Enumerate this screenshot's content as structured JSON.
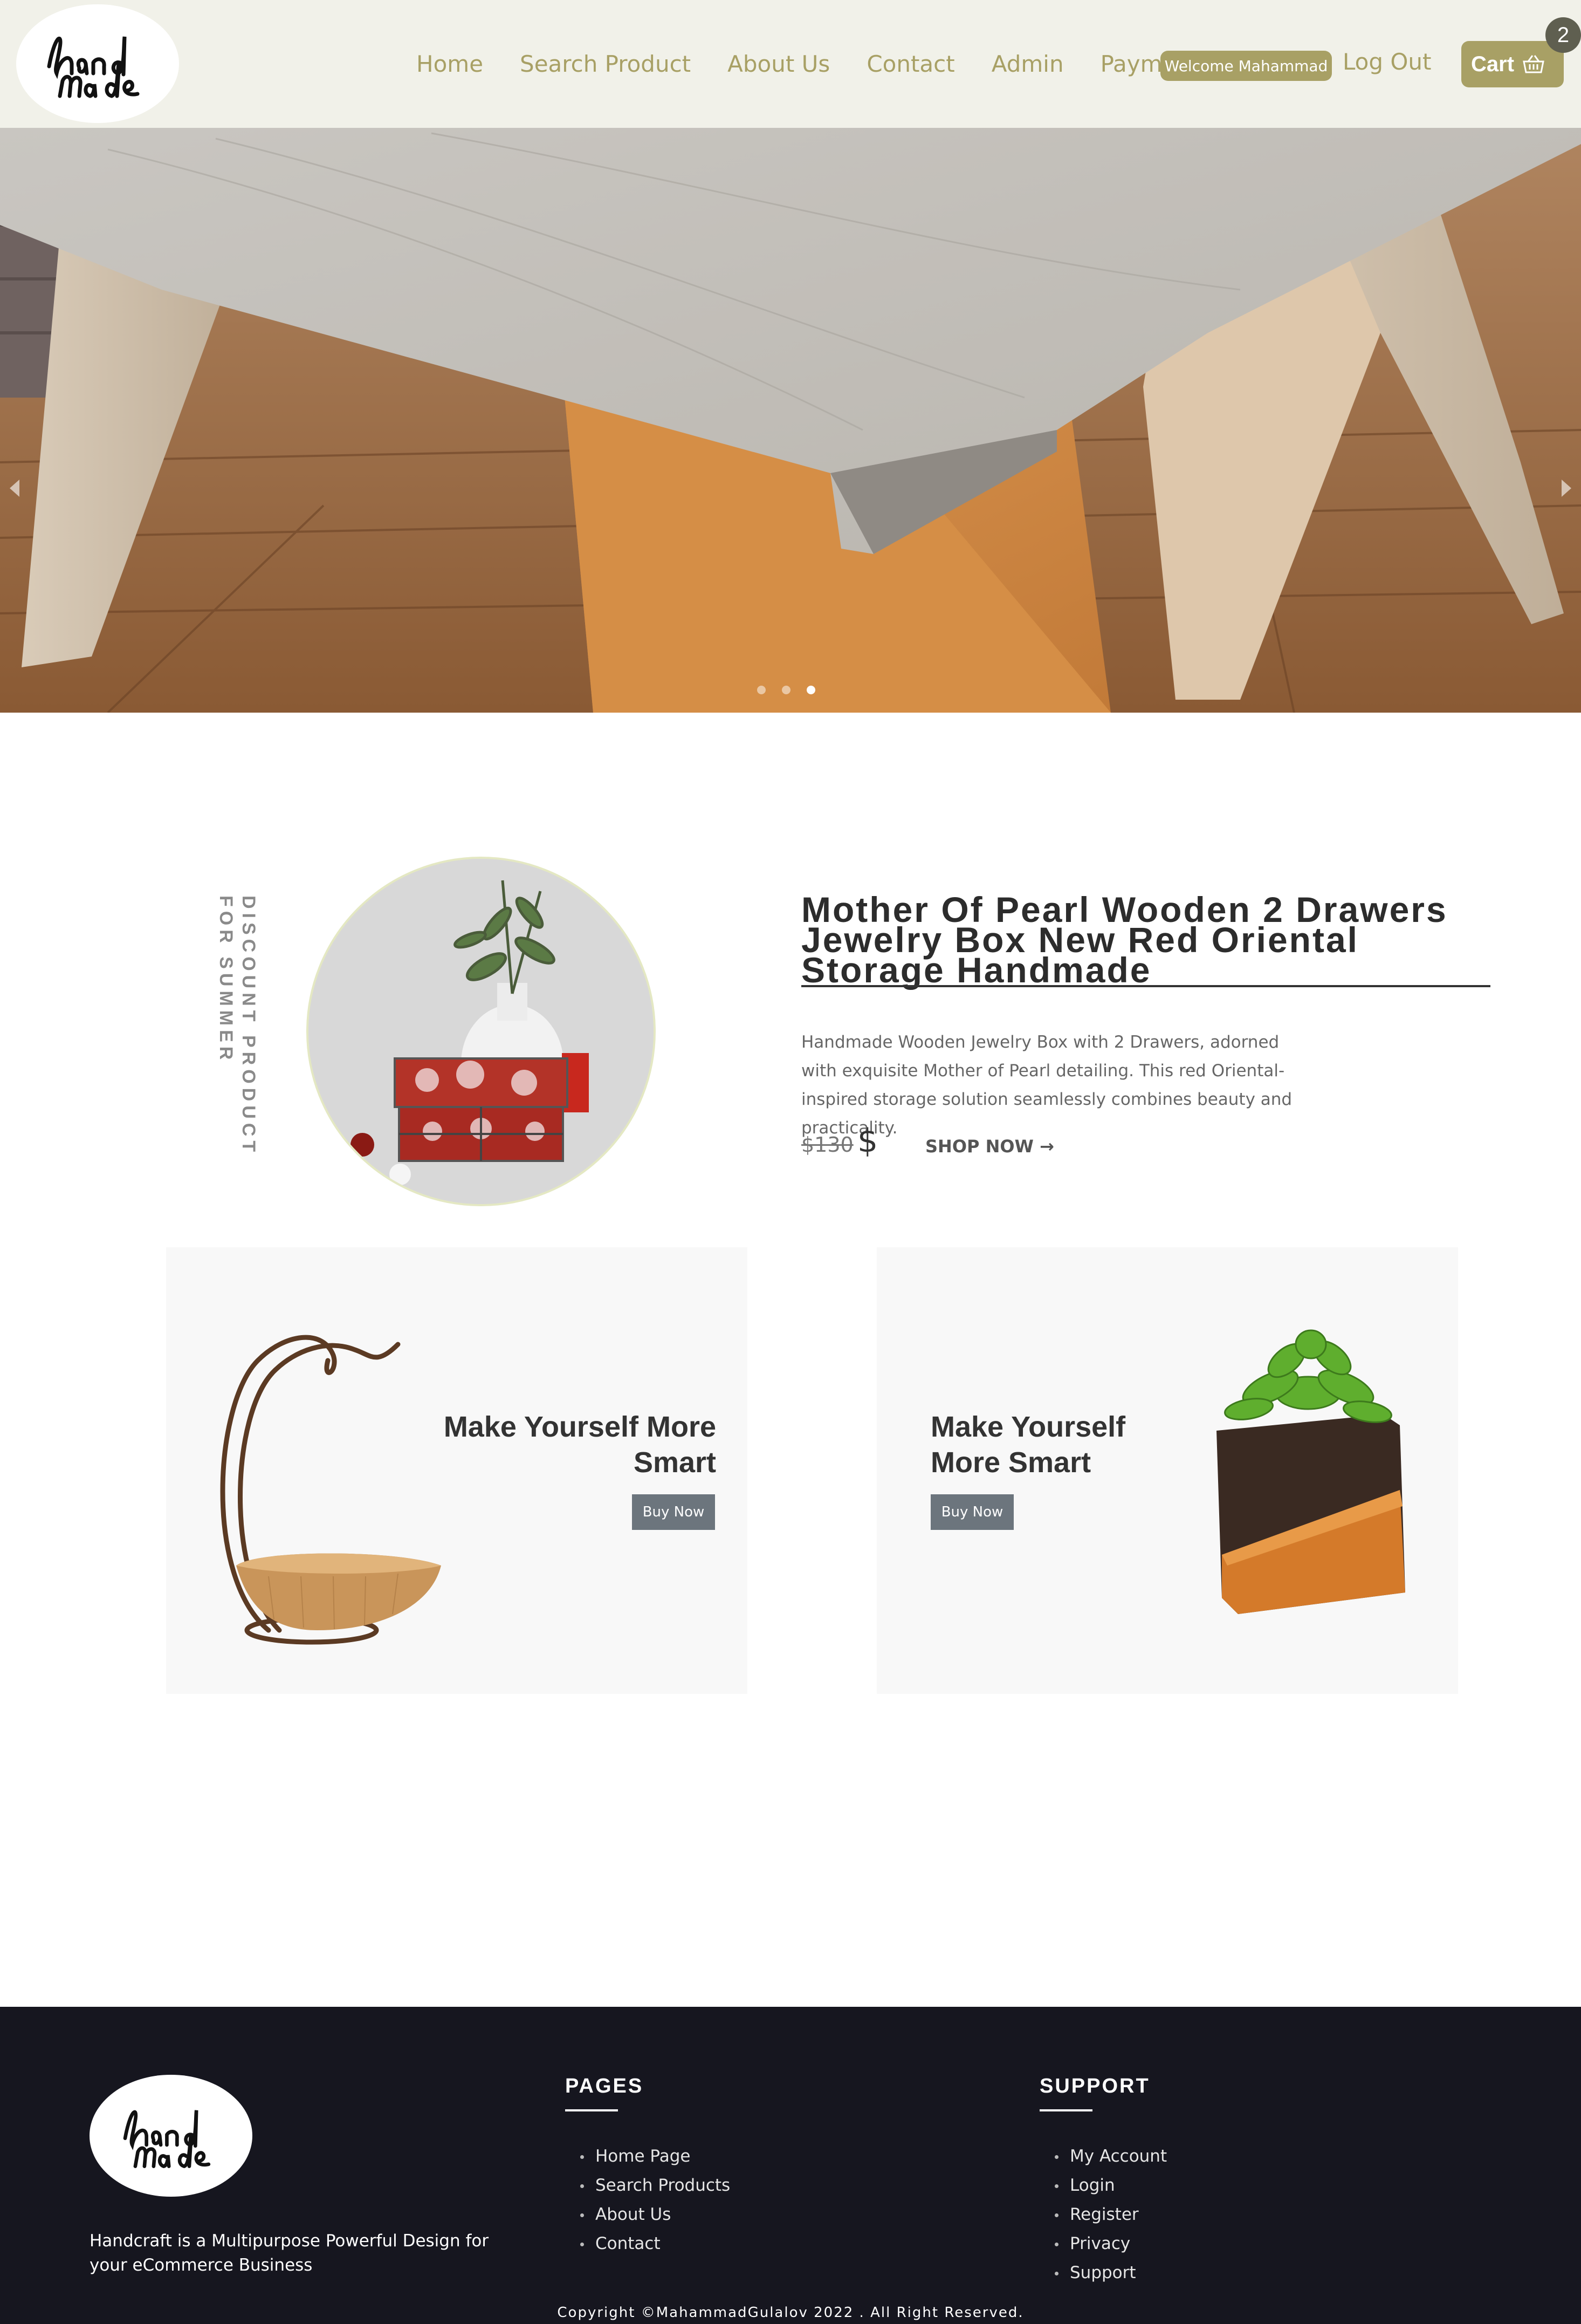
{
  "nav": {
    "logo_text": "hand made",
    "links": [
      "Home",
      "Search Product",
      "About Us",
      "Contact",
      "Admin",
      "Payment"
    ],
    "welcome": "Welcome Mahammad",
    "logout": "Log Out",
    "cart_label": "Cart",
    "cart_count": "2",
    "colors": {
      "accent": "#a8a065",
      "background": "#f1f1e9"
    }
  },
  "hero": {
    "slides_total": 3,
    "active_slide": 3,
    "icons": [
      "chevron-left-icon",
      "chevron-right-icon"
    ]
  },
  "featured": {
    "side_label": "DISCOUNT PRODUCT FOR SUMMER",
    "title": "Mother Of Pearl Wooden 2 Drawers Jewelry Box New Red Oriental Storage Handmade",
    "description": "Handmade Wooden Jewelry Box with 2 Drawers, adorned with exquisite Mother of Pearl detailing. This red Oriental-inspired storage solution seamlessly combines beauty and practicality.",
    "price_old": "$130",
    "price_current": "$",
    "shop_now": "SHOP NOW →"
  },
  "promos": [
    {
      "title": "Make Yourself More Smart",
      "button": "Buy Now"
    },
    {
      "title": "Make Yourself More Smart",
      "button": "Buy Now"
    }
  ],
  "footer": {
    "logo_text": "hand made",
    "tagline": "Handcraft is a Multipurpose Powerful Design for your eCommerce Business",
    "pages_heading": "PAGES",
    "pages": [
      "Home Page",
      "Search Products",
      "About Us",
      "Contact"
    ],
    "support_heading": "SUPPORT",
    "support": [
      "My Account",
      "Login",
      "Register",
      "Privacy",
      "Support"
    ],
    "copyright": "Copyright ©MahammadGulalov 2022 . All Right Reserved.",
    "colors": {
      "background": "#16161f"
    }
  }
}
